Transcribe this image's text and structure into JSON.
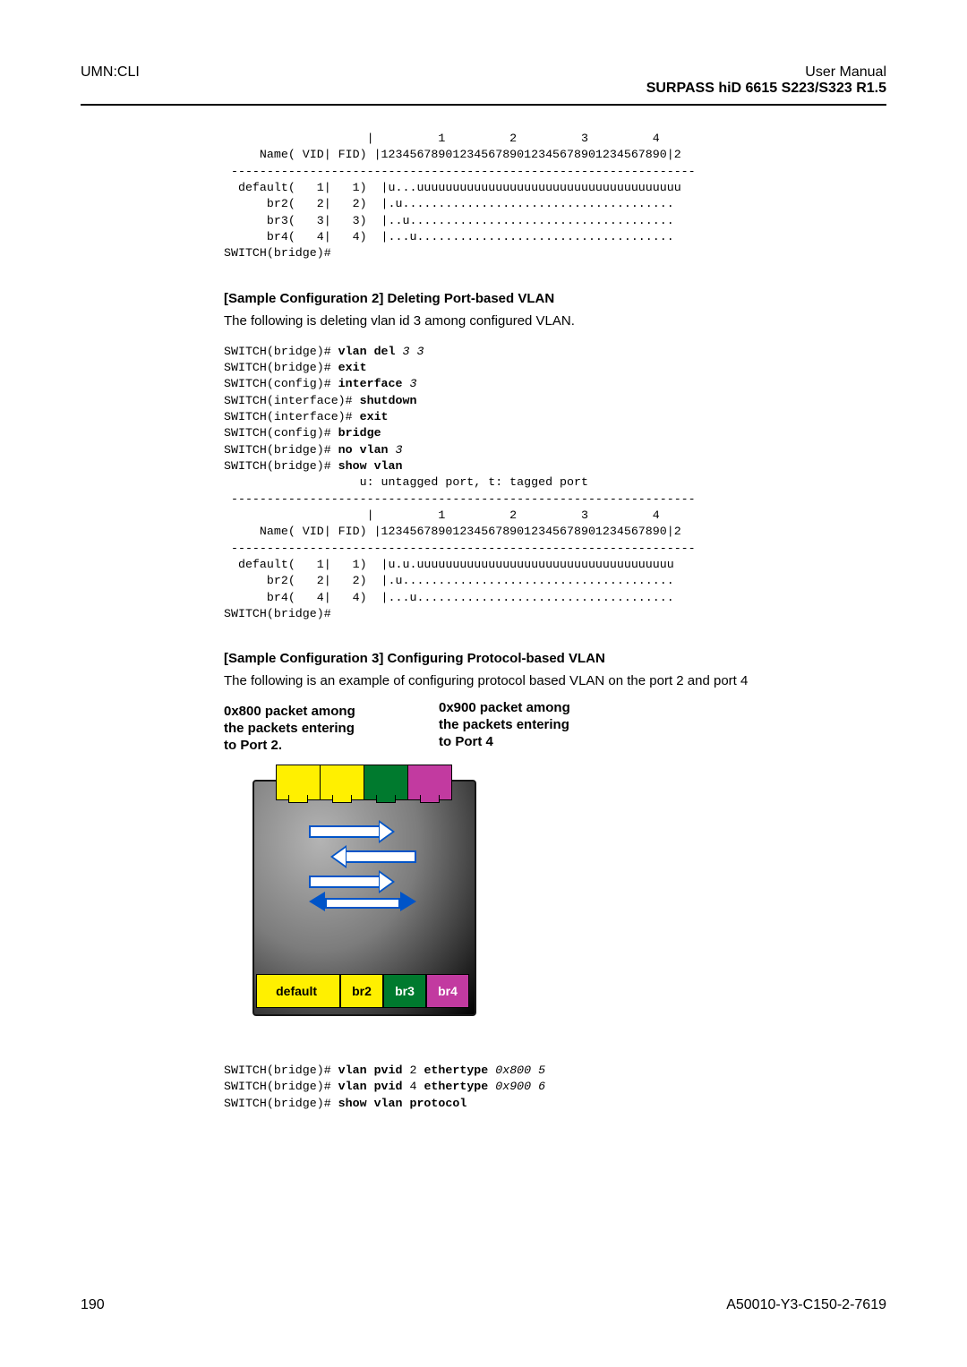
{
  "header": {
    "left": "UMN:CLI",
    "right_title": "User Manual",
    "right_sub": "SURPASS hiD 6615 S223/S323 R1.5"
  },
  "code_top": [
    "                    |         1         2         3         4",
    "     Name( VID| FID) |1234567890123456789012345678901234567890|2",
    " -----------------------------------------------------------------",
    "  default(   1|   1)  |u...uuuuuuuuuuuuuuuuuuuuuuuuuuuuuuuuuuuuu",
    "      br2(   2|   2)  |.u......................................",
    "      br3(   3|   3)  |..u.....................................",
    "      br4(   4|   4)  |...u....................................",
    "SWITCH(bridge)#"
  ],
  "sec2_head": "[Sample Configuration 2] Deleting Port-based VLAN",
  "sec2_body": "The following is deleting vlan id 3 among configured VLAN.",
  "code_mid_lines": [
    {
      "p": "SWITCH(bridge)# ",
      "b": "vlan del ",
      "i": "3 3"
    },
    {
      "p": "SWITCH(bridge)# ",
      "b": "exit"
    },
    {
      "p": "SWITCH(config)# ",
      "b": "interface ",
      "i": "3"
    },
    {
      "p": "SWITCH(interface)# ",
      "b": "shutdown"
    },
    {
      "p": "SWITCH(interface)# ",
      "b": "exit"
    },
    {
      "p": "SWITCH(config)# ",
      "b": "bridge"
    },
    {
      "p": "SWITCH(bridge)# ",
      "b": "no vlan ",
      "i": "3"
    },
    {
      "p": "SWITCH(bridge)# ",
      "b": "show vlan"
    }
  ],
  "code_mid_rest": [
    "                   u: untagged port, t: tagged port",
    " -----------------------------------------------------------------",
    "                    |         1         2         3         4",
    "     Name( VID| FID) |1234567890123456789012345678901234567890|2",
    " -----------------------------------------------------------------",
    "  default(   1|   1)  |u.u.uuuuuuuuuuuuuuuuuuuuuuuuuuuuuuuuuuuu",
    "      br2(   2|   2)  |.u......................................",
    "      br4(   4|   4)  |...u....................................",
    "SWITCH(bridge)#"
  ],
  "sec3_head": "[Sample Configuration 3] Configuring Protocol-based VLAN",
  "sec3_body": "The following is an example of configuring protocol based VLAN on the port 2 and port 4",
  "diagram": {
    "cap_left": "0x800 packet among\nthe packets entering\nto Port 2.",
    "cap_right": "0x900 packet among\nthe packets entering\nto Port 4",
    "br2": "br2",
    "br3": "br3",
    "br4": "br4"
  },
  "code_bot_lines": [
    {
      "p": "SWITCH(bridge)# ",
      "b": "vlan pvid ",
      "a1": "2 ",
      "b2": "ethertype ",
      "i": "0x800 5"
    },
    {
      "p": "SWITCH(bridge)# ",
      "b": "vlan pvid ",
      "a1": "4 ",
      "b2": "ethertype ",
      "i": "0x900 6"
    },
    {
      "p": "SWITCH(bridge)# ",
      "b": "show vlan protocol"
    }
  ],
  "footer": {
    "left": "190",
    "right": "A50010-Y3-C150-2-7619"
  }
}
